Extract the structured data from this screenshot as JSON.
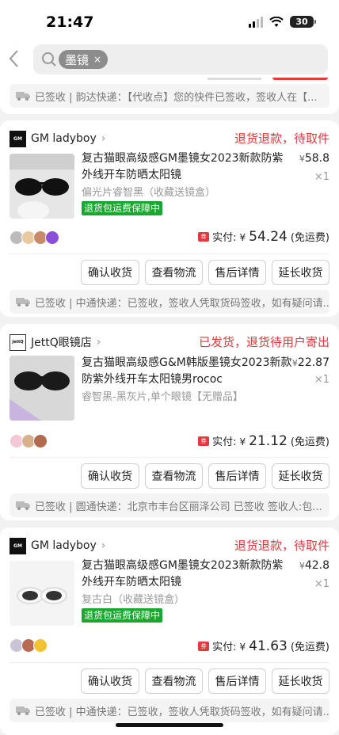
{
  "status_bar": {
    "time": "21:47",
    "battery": "30"
  },
  "search": {
    "chip": "墨镜",
    "chip_close": "×"
  },
  "orders": [
    {
      "shop_name": "GM ladyboy",
      "shop_logo": "GM",
      "status": "退货退款，待取件",
      "title": "复古猫眼高级感GM墨镜女2023新款防紫外线开车防晒太阳镜",
      "spec": "偏光片睿智黑（收藏送镜盒）",
      "guarantee": "退货包运费保障中",
      "price": "58.8",
      "qty": "×1",
      "paid_label": "实付:",
      "paid_amount": "54.24",
      "paid_note": "(免运费)",
      "actions": [
        "确认收货",
        "查看物流",
        "售后详情",
        "延长收货"
      ],
      "tracking": "已签收 | 中通快递：已签收，签收人凭取货码签收，如有疑问请..."
    },
    {
      "shop_name": "JettQ眼镜店",
      "shop_logo": "JettQ",
      "status": "已发货，退货待用户寄出",
      "title": "复古猫眼高级感G&M韩版墨镜女2023新款防紫外线开车太阳镜男rococ",
      "spec": "睿智黑-黑灰片,单个眼镜【无赠品】",
      "guarantee": "",
      "price": "22.87",
      "qty": "×1",
      "paid_label": "实付:",
      "paid_amount": "21.12",
      "paid_note": "(免运费)",
      "actions": [
        "确认收货",
        "查看物流",
        "售后详情",
        "延长收货"
      ],
      "tracking": "已签收 | 圆通快递：北京市丰台区丽泽公司 已签收 签收人:包..."
    },
    {
      "shop_name": "GM ladyboy",
      "shop_logo": "GM",
      "status": "退货退款，待取件",
      "title": "复古猫眼高级感GM墨镜女2023新款防紫外线开车防晒太阳镜",
      "spec": "复古白（收藏送镜盒）",
      "guarantee": "退货包运费保障中",
      "price": "42.8",
      "qty": "×1",
      "paid_label": "实付:",
      "paid_amount": "41.63",
      "paid_note": "(免运费)",
      "actions": [
        "确认收货",
        "查看物流",
        "售后详情",
        "延长收货"
      ],
      "tracking": "已签收 | 中通快递：已签收，签收人凭取货码签收，如有疑问请..."
    }
  ],
  "top_tracking": "已签收 | 韵达快递：【代收点】您的快件已签收，签收人在【...",
  "currency": "¥",
  "coupon_tag": "券",
  "colors": {
    "accent_red": "#e4393c",
    "guarantee_green": "#1aa72e"
  },
  "icons": [
    "back-icon",
    "search-icon",
    "truck-icon",
    "signal-icon",
    "wifi-icon",
    "battery-icon"
  ]
}
